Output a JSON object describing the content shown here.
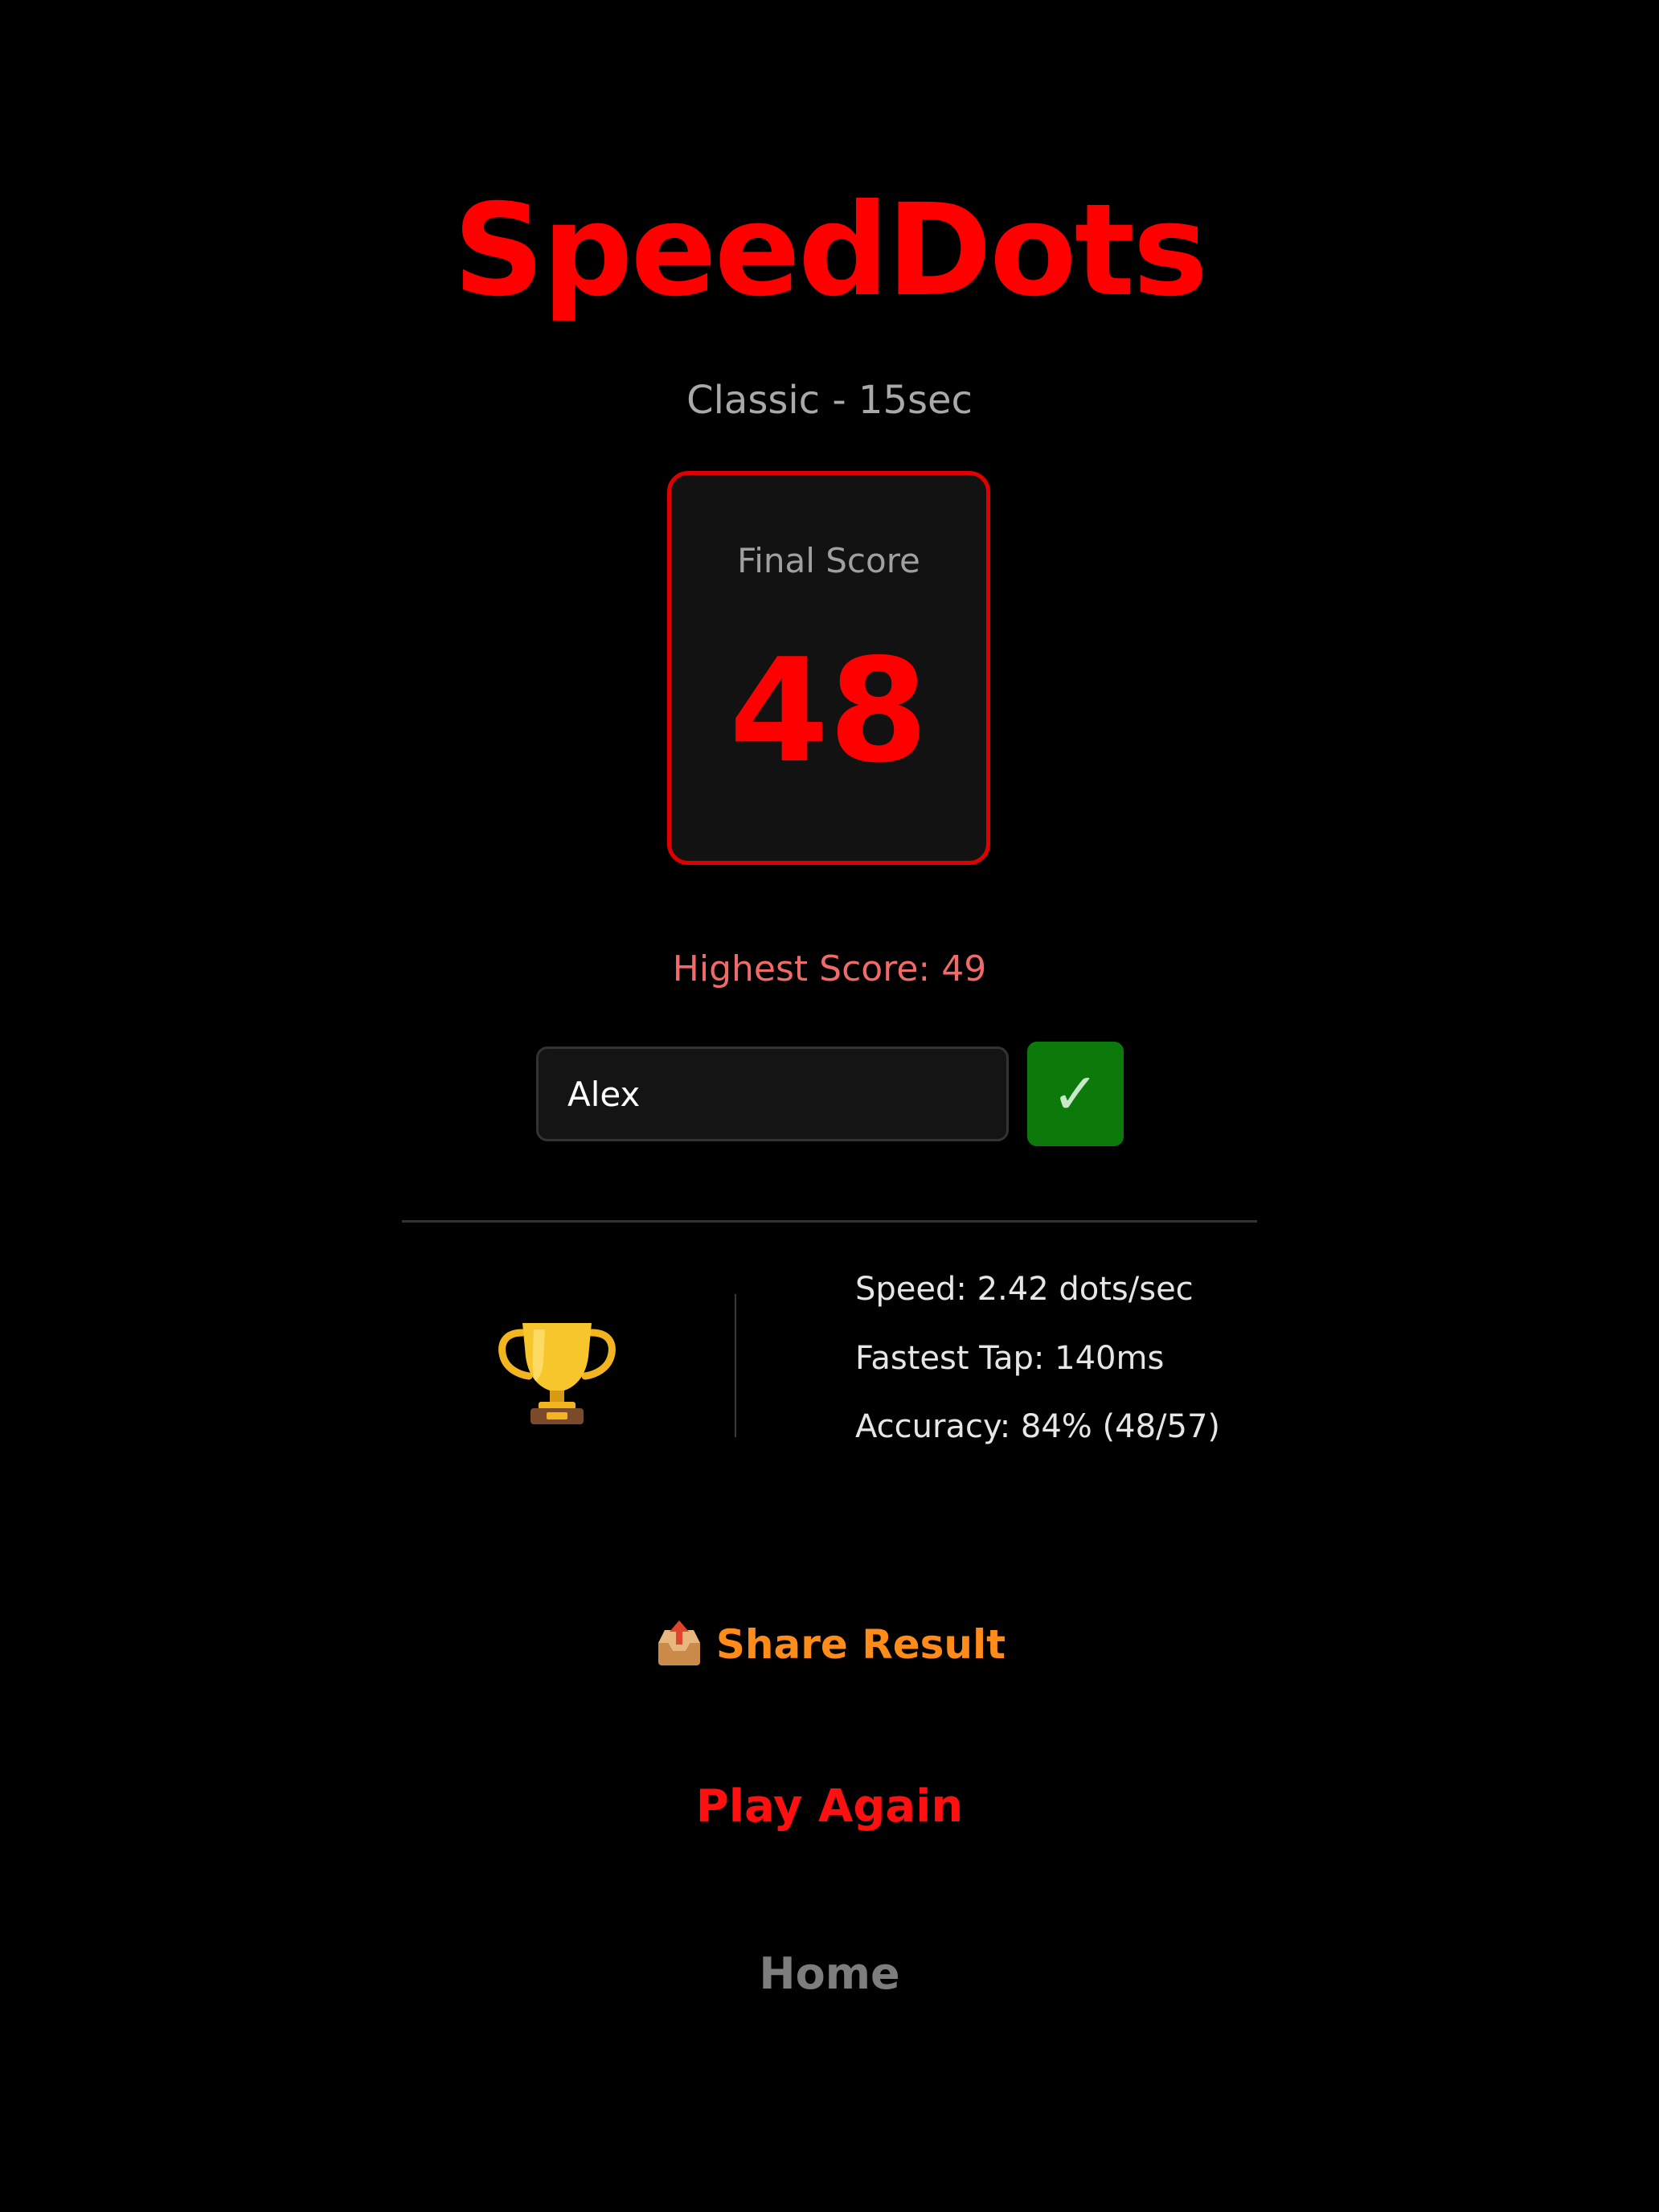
{
  "app": {
    "title": "SpeedDots",
    "mode": "Classic - 15sec"
  },
  "score_card": {
    "label": "Final Score",
    "value": "48"
  },
  "highest_score": "Highest Score: 49",
  "name_entry": {
    "value": "Alex",
    "confirm_label": "✓"
  },
  "stats": {
    "icon": "trophy-icon",
    "speed": "Speed: 2.42 dots/sec",
    "fastest_tap": "Fastest Tap: 140ms",
    "accuracy": "Accuracy: 84% (48/57)"
  },
  "actions": {
    "share_icon": "outbox-tray-icon",
    "share_label": "Share Result",
    "play_again_label": "Play Again",
    "home_label": "Home"
  },
  "colors": {
    "brand_red": "#ff0000",
    "highscore": "#f06a6a",
    "share_orange": "#ff8c1a",
    "confirm_green": "#0b7a0b",
    "home_gray": "#7d7d7d",
    "background": "#000000"
  }
}
